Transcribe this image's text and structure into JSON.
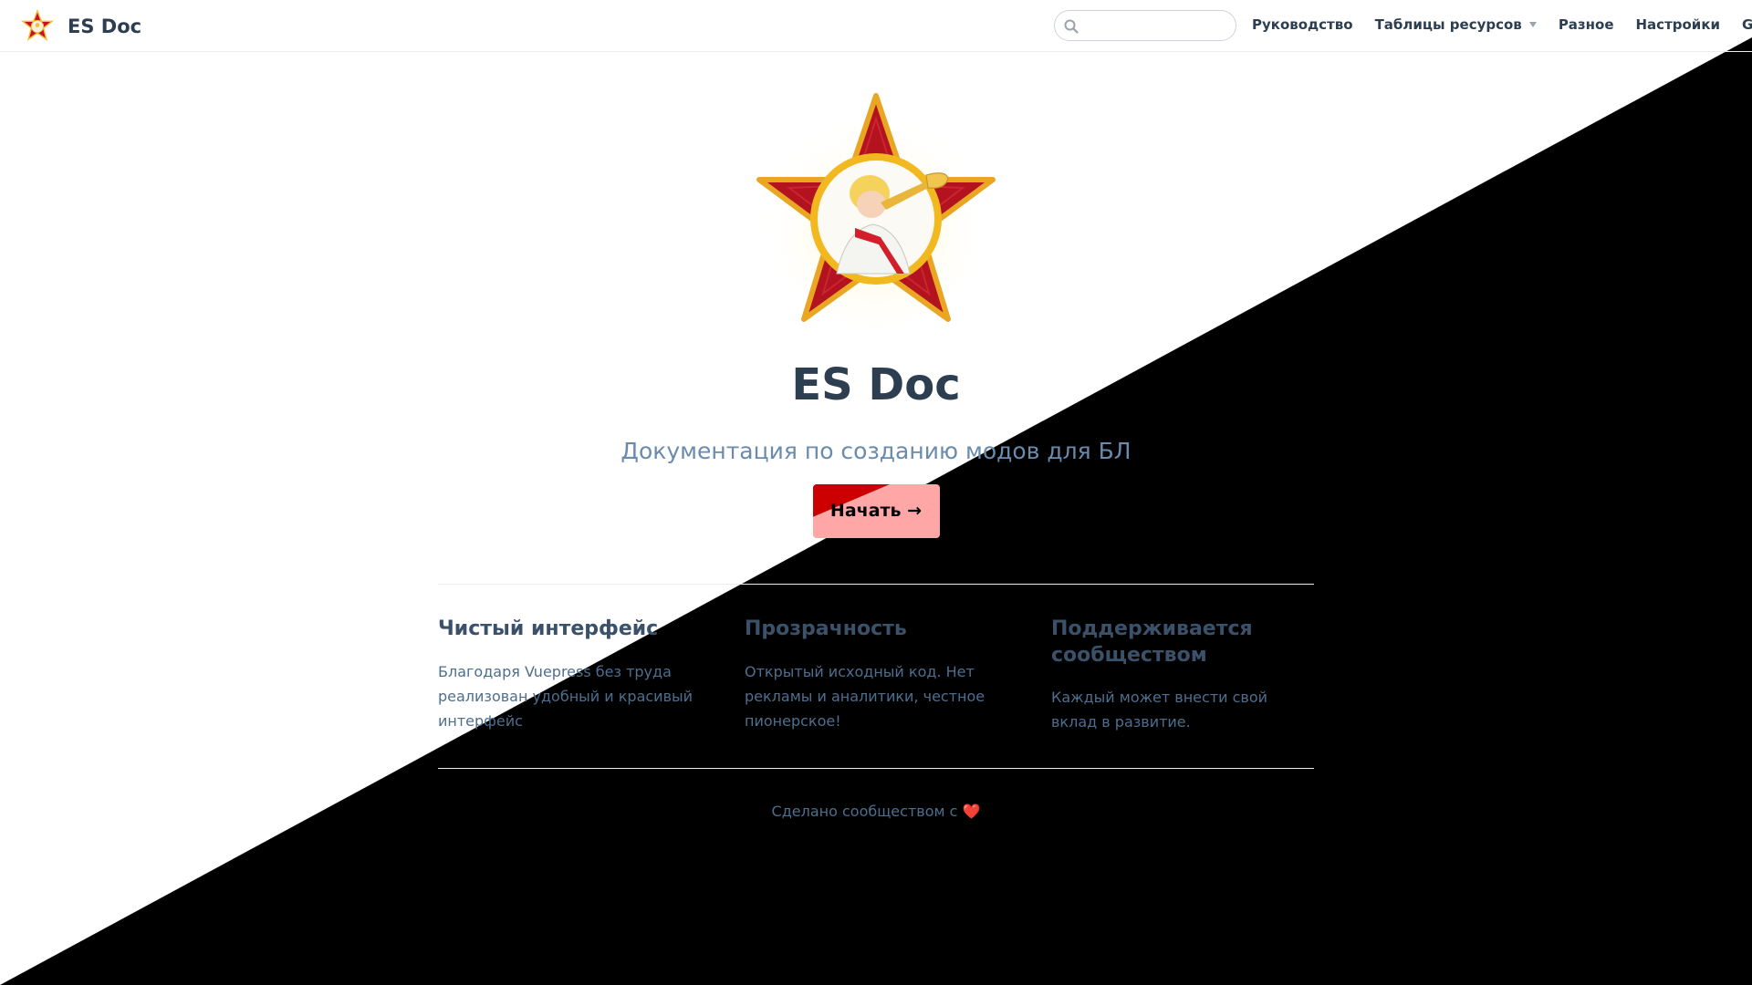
{
  "site": {
    "title": "ES Doc"
  },
  "search": {
    "placeholder": "",
    "value": ""
  },
  "nav": {
    "items": [
      "Руководство",
      "Таблицы ресурсов",
      "Разное",
      "Настройки",
      "GitHub"
    ]
  },
  "hero": {
    "title": "ES Doc",
    "description": "Документация по созданию модов для БЛ",
    "action": "Начать →"
  },
  "features": [
    {
      "title": "Чистый интерфейс",
      "details": "Благодаря Vuepress без труда реализован удобный и красивый интерфейс"
    },
    {
      "title": "Прозрачность",
      "details": "Открытый исходный код. Нет рекламы и аналитики, честное пионерское!"
    },
    {
      "title": "Поддерживается сообществом",
      "details": "Каждый может внести свой вклад в развитие."
    }
  ],
  "footer": {
    "text": "Сделано сообществом с",
    "heart": "❤️"
  },
  "colors": {
    "accent": "#cc0000",
    "button_light": "#ffa7a7",
    "text": "#2c3e50",
    "muted": "#6a8bad"
  }
}
